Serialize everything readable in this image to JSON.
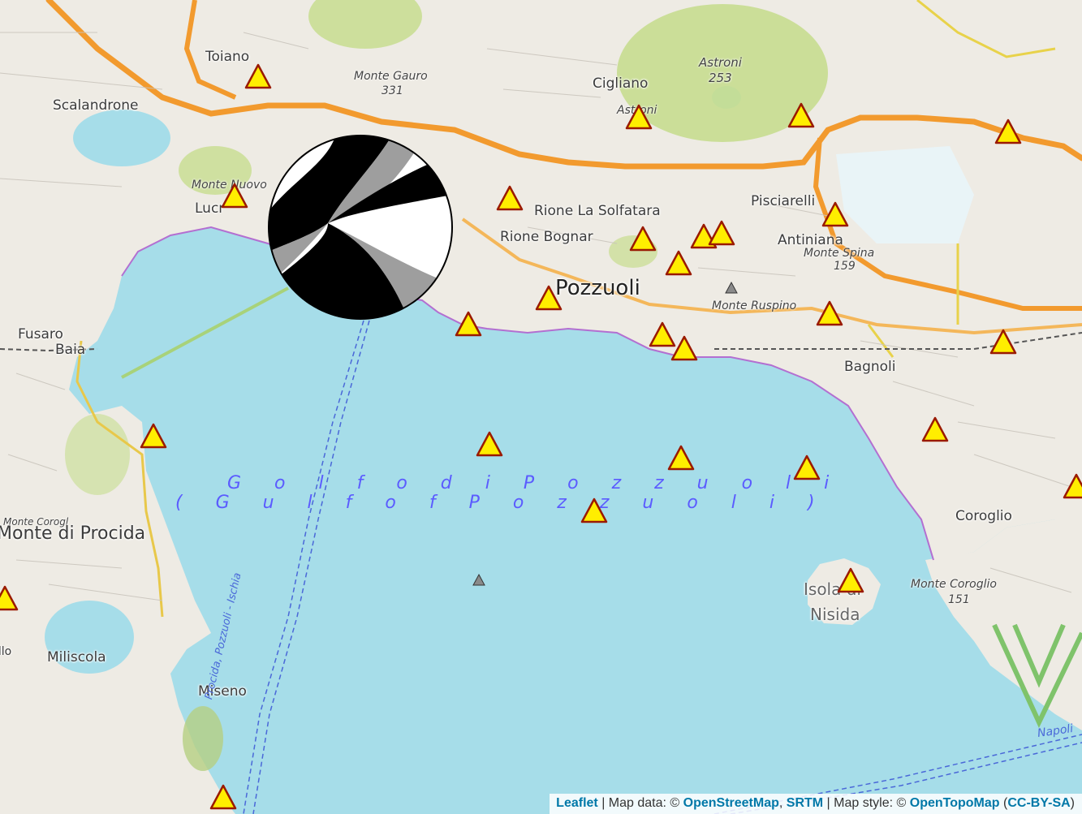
{
  "map": {
    "places": {
      "toiano": "Toiano",
      "scalandrone": "Scalandrone",
      "monte_gauro": "Monte Gauro",
      "monte_gauro_el": "331",
      "cigliano": "Cigliano",
      "astroni": "Astroni",
      "astroni_el": "253",
      "astroni_small": "Astroni",
      "monte_nuovo": "Monte Nuovo",
      "lucrino": "Lucr",
      "rione_solfatara": "Rione La Solfatara",
      "rione_bognar": "Rione Bognar",
      "pisciarelli": "Pisciarelli",
      "antiniana": "Antiniana",
      "monte_spina": "Monte Spina",
      "monte_spina_el": "159",
      "pozzuoli": "Pozzuoli",
      "monte_ruspino": "Monte Ruspino",
      "fusaro": "Fusaro",
      "baia": "Baia",
      "bagnoli": "Bagnoli",
      "coroglio": "Coroglio",
      "monte_di_procida": "Monte di Procida",
      "monte_corogl": "Monte Corogl",
      "monte_coroglio": "Monte Coroglio",
      "monte_coroglio_el": "151",
      "isola_di": "Isola di",
      "nisida": "Nisida",
      "miliscola": "Miliscola",
      "miseno": "Miseno",
      "napoli": "Napoli",
      "ferry_route": "Procida, Pozzuoli - Ischia",
      "gulf_it": "G o l f o   d i   P o z z u o l i",
      "gulf_en": "( G u l f   o f   P o z z u o l i )",
      "edge_illo": "illo"
    },
    "colors": {
      "sea": "#a6dde9",
      "land": "#f1efe9",
      "marker_fill": "#ffee00",
      "marker_stroke": "#9a1a00",
      "road": "#f29a2e"
    },
    "markers": {
      "seismic_station_count": 31,
      "minor_marker_count": 2,
      "focal_mechanism": "beachball"
    }
  },
  "attribution": {
    "leaflet": "Leaflet",
    "sep1": " | Map data: © ",
    "osm": "OpenStreetMap",
    "comma": ", ",
    "srtm": "SRTM",
    "sep2": " | Map style: © ",
    "otm": "OpenTopoMap",
    "open_paren": " (",
    "license": "CC-BY-SA",
    "close_paren": ")"
  }
}
